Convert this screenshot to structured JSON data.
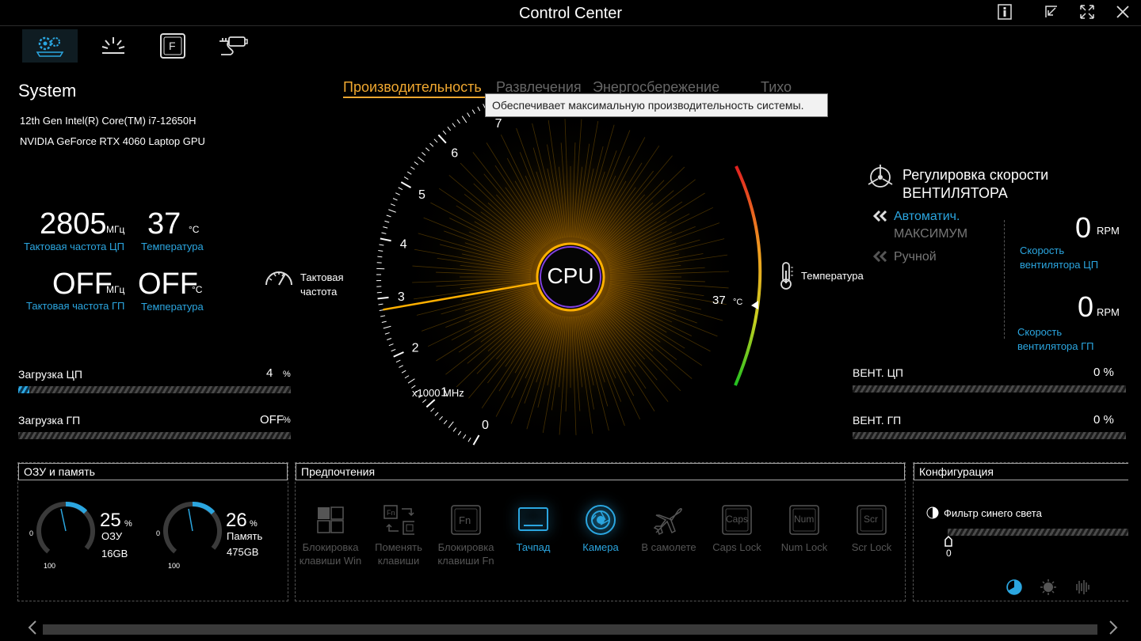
{
  "window": {
    "title": "Control Center"
  },
  "nav": [
    {
      "name": "system-settings-icon"
    },
    {
      "name": "lighting-icon"
    },
    {
      "name": "function-key-icon"
    },
    {
      "name": "battery-plug-icon"
    }
  ],
  "system": {
    "title": "System",
    "cpu_name": "12th Gen Intel(R) Core(TM) i7-12650H",
    "gpu_name": "NVIDIA GeForce RTX 4060 Laptop GPU",
    "cpu_clock": {
      "value": "2805",
      "unit": "МГц",
      "label": "Тактовая частота ЦП"
    },
    "cpu_temp": {
      "value": "37",
      "unit": "°C",
      "label": "Температура"
    },
    "gpu_clock": {
      "value": "OFF",
      "unit": "МГц",
      "label": "Тактовая частота ГП"
    },
    "gpu_temp": {
      "value": "OFF",
      "unit": "°C",
      "label": "Температура"
    },
    "cpu_load": {
      "label": "Загрузка ЦП",
      "value": "4",
      "unit": "%",
      "fraction": 0.04
    },
    "gpu_load": {
      "label": "Загрузка ГП",
      "value": "OFF",
      "unit": "%",
      "fraction": 0
    }
  },
  "modes": {
    "tabs": [
      "Производительность",
      "Развлечения",
      "Энергосбережение",
      "Тихо"
    ],
    "active": 0,
    "tooltip": "Обеспечивает максимальную производительность системы."
  },
  "gauge": {
    "center_label": "CPU",
    "clock_label_1": "Тактовая",
    "clock_label_2": "частота",
    "scale_label": "x1000 MHz",
    "ticks": [
      "0",
      "1",
      "2",
      "3",
      "4",
      "5",
      "6",
      "7"
    ],
    "needle_value": 2.805,
    "temp_label": "Температура",
    "temp_value": "37",
    "temp_unit": "°C"
  },
  "fan": {
    "title_1": "Регулировка скорости",
    "title_2": "ВЕНТИЛЯТОРА",
    "mode_auto": "Автоматич.",
    "mode_max": "МАКСИМУМ",
    "mode_manual": "Ручной",
    "cpu_fan": {
      "value": "0",
      "unit": "RPM",
      "label_1": "Скорость",
      "label_2": "вентилятора ЦП"
    },
    "gpu_fan": {
      "value": "0",
      "unit": "RPM",
      "label_1": "Скорость",
      "label_2": "вентилятора ГП"
    },
    "cpu_fan_bar": {
      "label": "ВЕНТ. ЦП",
      "value": "0 %",
      "fraction": 0
    },
    "gpu_fan_bar": {
      "label": "ВЕНТ. ГП",
      "value": "0 %",
      "fraction": 0
    }
  },
  "memory": {
    "title": "ОЗУ и память",
    "ram": {
      "percent": "25",
      "unit": "%",
      "label": "ОЗУ",
      "size": "16GB",
      "fraction": 0.25
    },
    "storage": {
      "percent": "26",
      "unit": "%",
      "label": "Память",
      "size": "475GB",
      "fraction": 0.26
    },
    "dial_min": "0",
    "dial_max": "100"
  },
  "preferences": {
    "title": "Предпочтения",
    "items": [
      {
        "l1": "Блокировка",
        "l2": "клавиши Win",
        "on": false
      },
      {
        "l1": "Поменять",
        "l2": "клавиши",
        "on": false
      },
      {
        "l1": "Блокировка",
        "l2": "клавиши Fn",
        "on": false
      },
      {
        "l1": "Тачпад",
        "l2": "",
        "on": true
      },
      {
        "l1": "Камера",
        "l2": "",
        "on": true
      },
      {
        "l1": "В самолете",
        "l2": "",
        "on": false
      },
      {
        "l1": "Caps Lock",
        "l2": "",
        "on": false
      },
      {
        "l1": "Num Lock",
        "l2": "",
        "on": false
      },
      {
        "l1": "Scr Lock",
        "l2": "",
        "on": false
      }
    ],
    "key_caps": {
      "fn": "Fn",
      "fn_small": "Fn",
      "caps": "Caps",
      "num": "Num",
      "scr": "Scr"
    }
  },
  "config": {
    "title": "Конфигурация",
    "blue_light_label": "Фильтр синего света",
    "blue_light_value": "0"
  }
}
